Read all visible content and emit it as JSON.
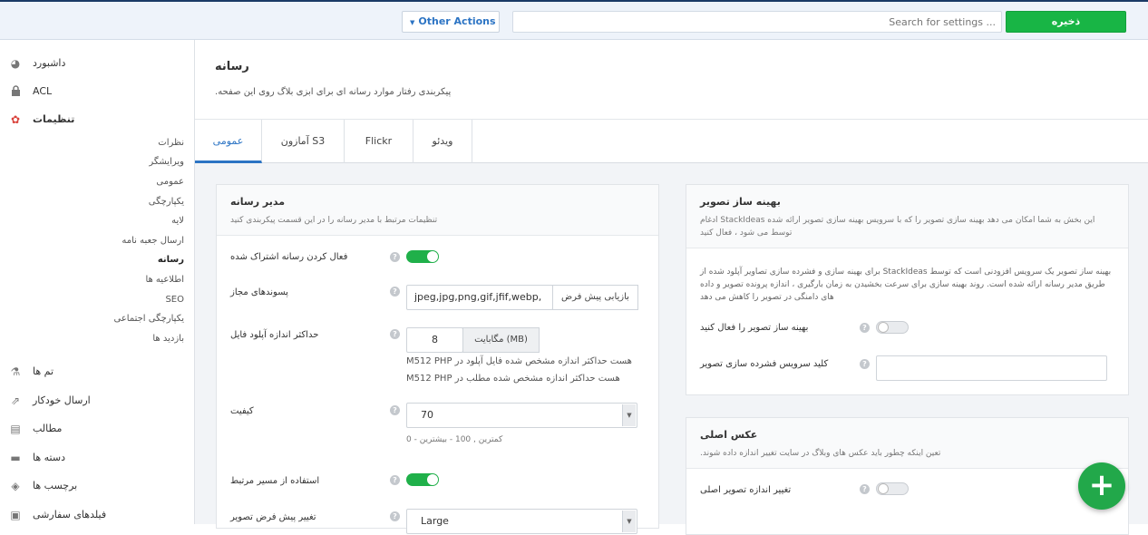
{
  "topbar": {
    "other_actions": "Other Actions",
    "search_placeholder": "Search for settings ...",
    "save": "ذخیره"
  },
  "sidebar": {
    "items_top": [
      {
        "label": "داشبورد",
        "icon": "dashboard-icon"
      },
      {
        "label": "ACL",
        "icon": "lock-icon"
      },
      {
        "label": "تنظیمات",
        "icon": "gear-icon"
      }
    ],
    "sub_items": [
      "نظرات",
      "ویرایشگر",
      "عمومی",
      "یکپارچگی",
      "لایه",
      "ارسال جعبه نامه",
      "رسانه",
      "اطلاعیه ها",
      "SEO",
      "یکپارچگی اجتماعی",
      "بازدید ها"
    ],
    "items_bottom": [
      {
        "label": "تم ها",
        "icon": "flask-icon"
      },
      {
        "label": "ارسال خودکار",
        "icon": "share-icon"
      },
      {
        "label": "مطالب",
        "icon": "document-icon"
      },
      {
        "label": "دسته ها",
        "icon": "folder-icon"
      },
      {
        "label": "برچسب ها",
        "icon": "tags-icon"
      },
      {
        "label": "فیلدهای سفارشی",
        "icon": "fields-icon"
      }
    ]
  },
  "page": {
    "title": "رسانه",
    "description": ".پیکربندی رفتار موارد رسانه ای برای ابزی بلاگ روی این صفحه"
  },
  "tabs": [
    "عمومی",
    "آمازون S3",
    "Flickr",
    "ویدئو"
  ],
  "media_manager": {
    "title": "مدیر رسانه",
    "subtitle": "تنظیمات مرتبط با مدیر رسانه را در این قسمت پیکربندی کنید",
    "enable_shared_label": "فعال کردن رسانه اشتراک شده",
    "allowed_ext_label": "پسوندهای مجاز",
    "allowed_ext_value": "jpeg,jpg,png,gif,jfif,webp,",
    "reset_default": "بازیابی پیش فرض",
    "max_upload_label": "حداکثر اندازه آپلود فایل",
    "max_upload_value": "8",
    "max_upload_unit": "مگابایت (MB)",
    "php_note_1": "M512 PHP هست حداکثر اندازه مشخص شده فایل آپلود در",
    "php_note_2": "M512 PHP هست حداکثر اندازه مشخص شده مطلب در",
    "quality_label": "کیفیت",
    "quality_value": "70",
    "quality_hint": "کمترین , 100 - بیشترین - 0",
    "relative_path_label": "استفاده از مسیر مرتبط",
    "default_size_label": "تغییر پیش فرض تصویر",
    "default_size_value": "Large"
  },
  "optimizer": {
    "title": "بهینه ساز تصویر",
    "subtitle": "ادغام StackIdeas این بخش به شما امکان می دهد بهینه سازی تصویر را که با سرویس بهینه سازی تصویر ارائه شده توسط می شود ، فعال کنید",
    "body": "برای بهینه سازی و فشرده سازی تصاویر آپلود شده از StackIdeas بهینه ساز تصویر یک سرویس افزودنی است که توسط طریق مدیر رسانه ارائه شده است. روند بهینه سازی برای سرعت بخشیدن به زمان بارگیری ، اندازه پرونده تصویر و داده های دامنگی در تصویر را کاهش می دهد",
    "enable_label": "بهینه ساز تصویر را فعال کنید",
    "key_label": "کلید سرویس فشرده سازی تصویر"
  },
  "original": {
    "title": "عکس اصلی",
    "subtitle": ".تعین اینکه چطور باید عکس های وبلاگ در سایت تغییر اندازه داده شوند",
    "resize_label": "تغییر اندازه تصویر اصلی"
  },
  "colors": {
    "save_green": "#18b545",
    "accent_blue": "#2c74c4",
    "toggle_green": "#20b04a",
    "fab_green": "#22a84a"
  }
}
